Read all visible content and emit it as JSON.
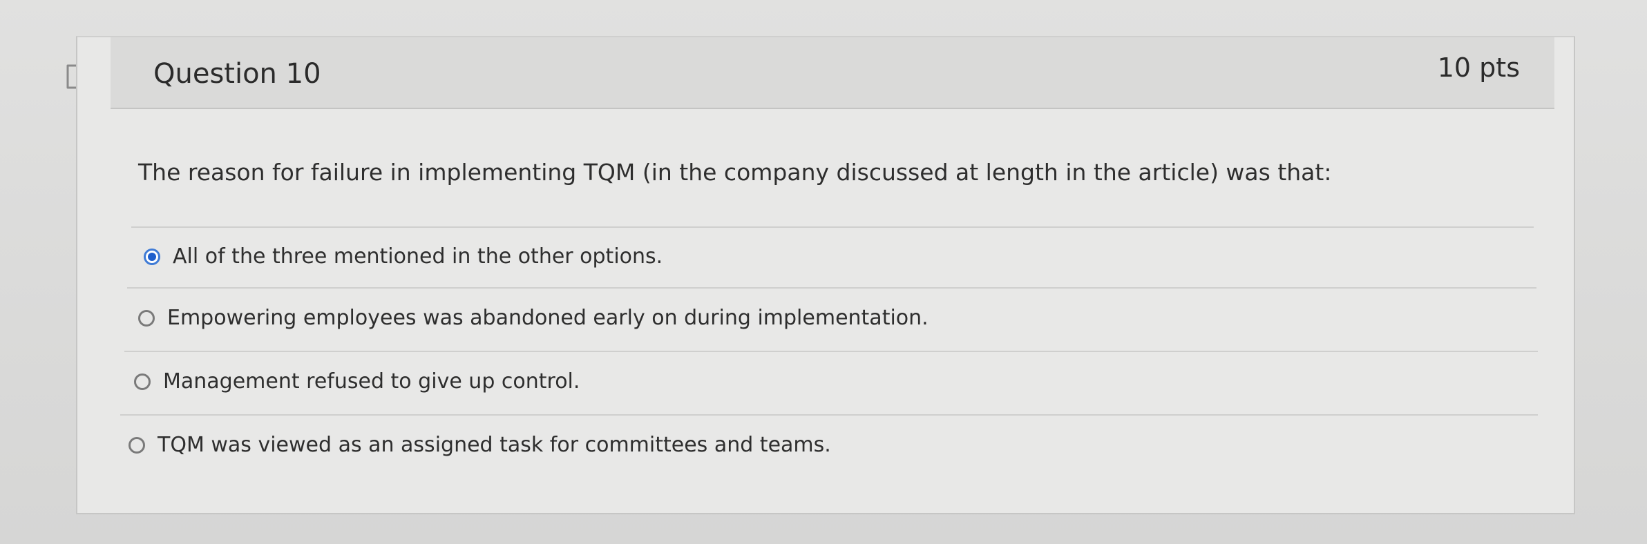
{
  "question": {
    "title": "Question 10",
    "points": "10 pts",
    "text": "The reason for failure in implementing TQM (in the company discussed at length in the article) was that:",
    "options": [
      {
        "label": "All of the three mentioned in the other options.",
        "selected": true
      },
      {
        "label": "Empowering employees was abandoned early on during implementation.",
        "selected": false
      },
      {
        "label": "Management refused to give up control.",
        "selected": false
      },
      {
        "label": "TQM was viewed as an assigned task for committees and teams.",
        "selected": false
      }
    ]
  },
  "colors": {
    "selected_radio": "#1f5fcc",
    "header_bg": "#dadad9",
    "card_bg": "#e8e8e7"
  },
  "icons": {
    "flag": "flag-icon"
  }
}
